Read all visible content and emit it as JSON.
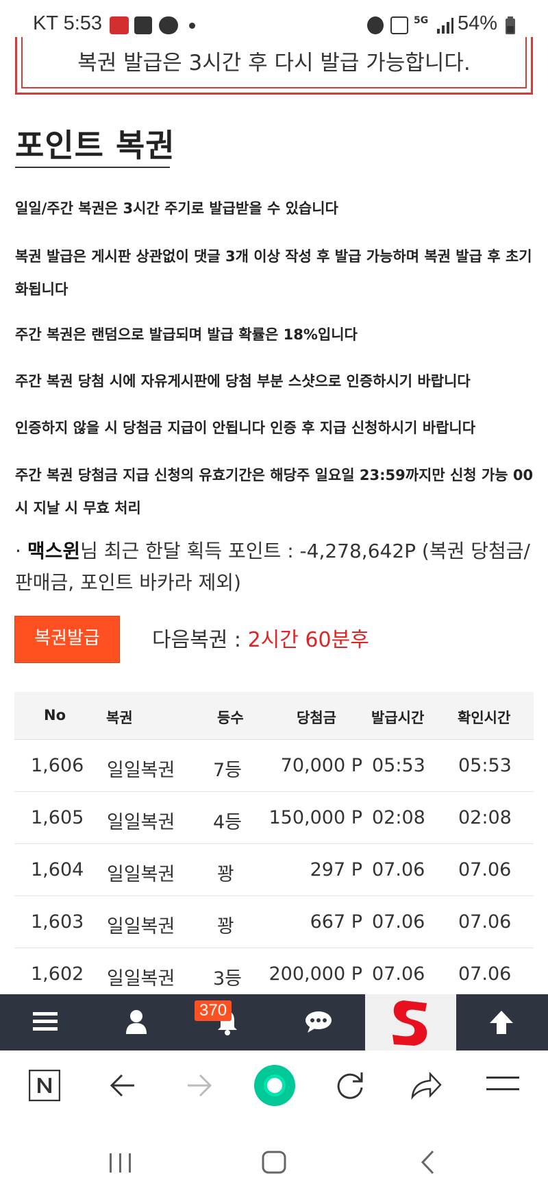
{
  "status_bar": {
    "carrier_time": "KT 5:53",
    "battery": "54%",
    "network": "5G"
  },
  "notice": {
    "text": "복권 발급은 3시간 후 다시 발급 가능합니다."
  },
  "page_title": "포인트 복권",
  "rules": [
    "일일/주간 복권은 3시간 주기로 발급받을 수 있습니다",
    "복권 발급은 게시판 상관없이 댓글 3개 이상 작성 후 발급 가능하며 복권 발급 후 초기화됩니다",
    "주간 복권은 랜덤으로 발급되며 발급 확률은 18%입니다",
    "주간 복권 당첨 시에 자유게시판에 당첨 부분 스샷으로 인증하시기 바랍니다",
    "인증하지 않을 시 당첨금 지급이 안됩니다 인증 후 지급 신청하시기 바랍니다",
    "주간 복권 당첨금 지급 신청의 유효기간은 해당주 일요일 23:59까지만 신청 가능 00시 지날 시 무효 처리"
  ],
  "user": {
    "bullet": "·",
    "name": "맥스윈",
    "suffix": "님 최근 한달 획득 포인트 : -4,278,642P (복권 당첨금/판매금, 포인트 바카라 제외)"
  },
  "issue_button": "복권발급",
  "next_lottery": {
    "label": "다음복권 : ",
    "value": "2시간 60분후"
  },
  "table": {
    "headers": [
      "No",
      "복권",
      "등수",
      "당첨금",
      "발급시간",
      "확인시간"
    ],
    "rows": [
      [
        "1,606",
        "일일복권",
        "7등",
        "70,000 P",
        "05:53",
        "05:53"
      ],
      [
        "1,605",
        "일일복권",
        "4등",
        "150,000 P",
        "02:08",
        "02:08"
      ],
      [
        "1,604",
        "일일복권",
        "꽝",
        "297 P",
        "07.06",
        "07.06"
      ],
      [
        "1,603",
        "일일복권",
        "꽝",
        "667 P",
        "07.06",
        "07.06"
      ],
      [
        "1,602",
        "일일복권",
        "3등",
        "200,000 P",
        "07.06",
        "07.06"
      ]
    ]
  },
  "site_nav": {
    "items": [
      "menu-icon",
      "user-icon",
      "bell-icon",
      "chat-icon",
      "site-logo",
      "arrow-up-icon"
    ],
    "notification_count": "370"
  },
  "browser_bar": {
    "items": [
      "naver-icon",
      "back-icon",
      "forward-icon",
      "home-icon",
      "refresh-icon",
      "share-icon",
      "menu-icon"
    ]
  },
  "colors": {
    "accent": "#ff5021",
    "notice_border": "#d43b3b",
    "next_value": "#e02424",
    "nav_bg": "#2e3440",
    "green": "#00c896"
  }
}
